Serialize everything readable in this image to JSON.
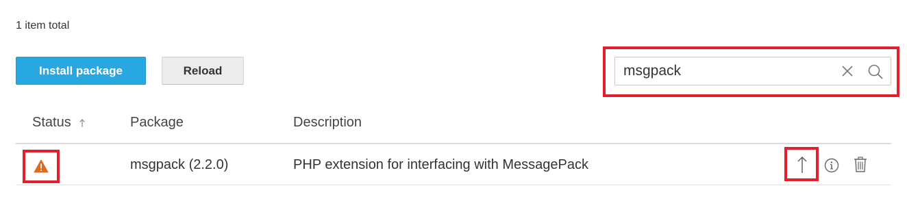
{
  "summary": {
    "total_text": "1 item total"
  },
  "toolbar": {
    "install_label": "Install package",
    "reload_label": "Reload"
  },
  "search": {
    "value": "msgpack",
    "placeholder": ""
  },
  "table": {
    "headers": {
      "status": "Status",
      "package": "Package",
      "description": "Description"
    },
    "sort": {
      "column": "status",
      "direction": "ascending"
    },
    "rows": [
      {
        "status_icon": "warning-icon",
        "package": "msgpack (2.2.0)",
        "description": "PHP extension for interfacing with MessagePack",
        "actions": [
          "upgrade-icon",
          "info-icon",
          "trash-icon"
        ]
      }
    ]
  },
  "colors": {
    "primary_button": "#28a8e0",
    "warning": "#e0691a",
    "highlight": "#e2202c"
  }
}
